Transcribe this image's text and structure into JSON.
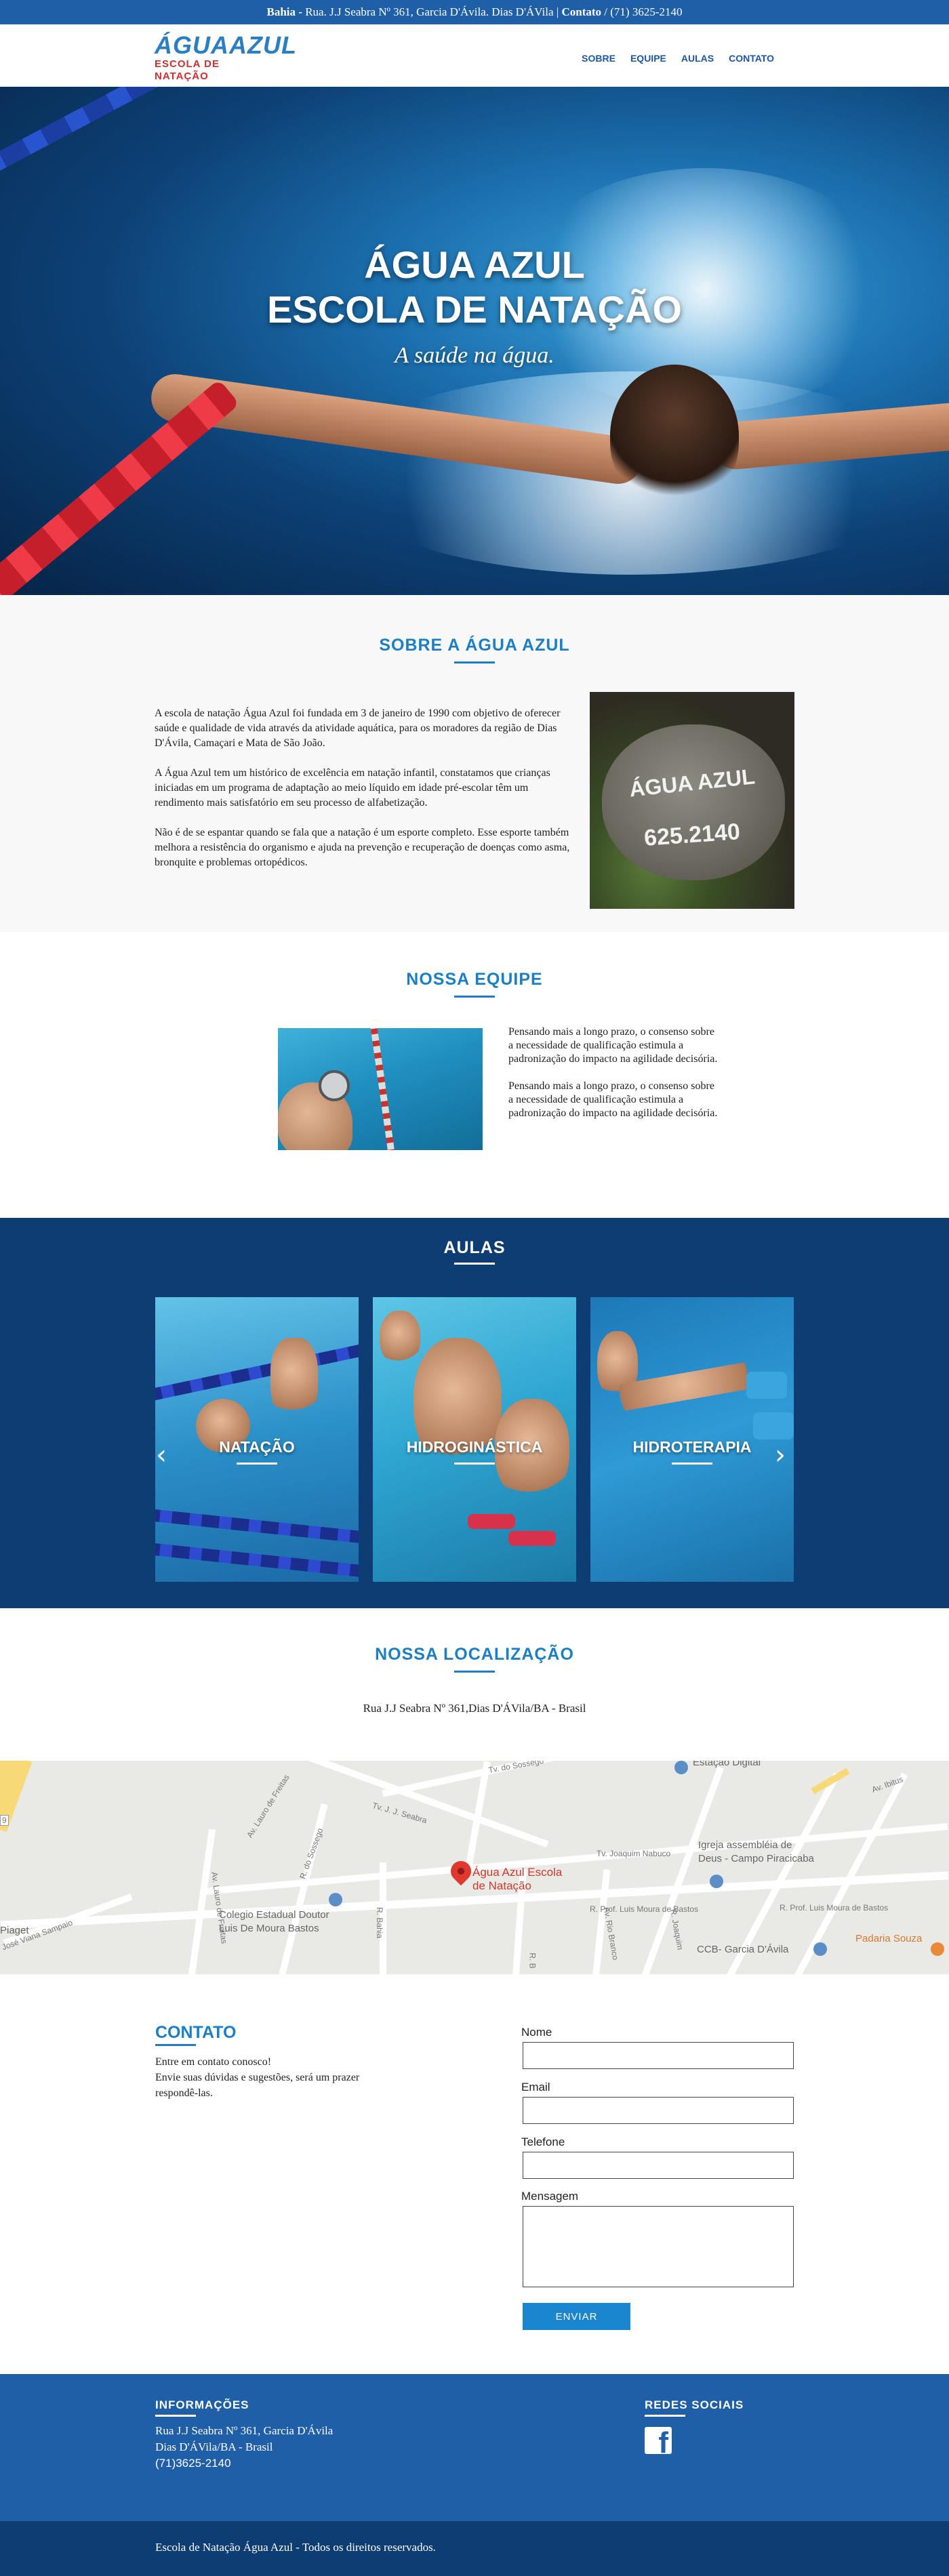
{
  "topbar": {
    "state": "Bahia",
    "dash": " - ",
    "address": "Rua. J.J Seabra Nº 361, Garcia D'Ávila. Dias D'ÁVila",
    "sep": " | ",
    "contact_label": "Contato",
    "phone": " / (71) 3625-2140"
  },
  "logo": {
    "top": "ÁGUAAZUL",
    "bottom": "ESCOLA DE NATAÇÃO"
  },
  "nav": [
    "SOBRE",
    "EQUIPE",
    "AULAS",
    "CONTATO"
  ],
  "hero": {
    "title_line1": "ÁGUA AZUL",
    "title_line2": "ESCOLA DE NATAÇÃO",
    "subtitle": "A saúde na água."
  },
  "sobre": {
    "title": "SOBRE A ÁGUA AZUL",
    "paragraphs": [
      "A escola de natação Água Azul foi fundada em 3 de janeiro de 1990 com objetivo de oferecer saúde e qualidade de vida através da atividade aquática, para os moradores da região de Dias D'Ávila, Camaçari e Mata de São João.",
      "A Água Azul tem um histórico de excelência em natação infantil, constatamos que crianças iniciadas em um programa de adaptação ao meio líquido em idade pré-escolar têm um rendimento mais satisfatório em seu processo de alfabetização.",
      "Não é de se espantar quando se fala que a natação é um esporte completo. Esse esporte também melhora a resistência do organismo e ajuda na prevenção e recuperação de doenças como asma, bronquite e problemas ortopédicos."
    ],
    "stone_text1": "ÁGUA AZUL",
    "stone_text2": "625.2140"
  },
  "equipe": {
    "title": "NOSSA EQUIPE",
    "paragraphs": [
      "Pensando mais a longo prazo, o consenso sobre a necessidade de qualificação estimula a padronização do impacto na agilidade decisória.",
      "Pensando mais a longo prazo, o consenso sobre a necessidade de qualificação estimula a padronização do impacto na agilidade decisória."
    ]
  },
  "aulas": {
    "title": "AULAS",
    "cards": [
      "NATAÇÃO",
      "HIDROGINÁSTICA",
      "HIDROTERAPIA"
    ],
    "prev_icon": "‹",
    "next_icon": "›"
  },
  "local": {
    "title": "NOSSA LOCALIZAÇÃO",
    "address": "Rua J.J Seabra Nº 361,Dias D'ÁVila/BA - Brasil"
  },
  "map": {
    "place_name_line1": "Água Azul Escola",
    "place_name_line2": "de Natação",
    "labels": {
      "colegio_line1": "Colegio Estadual Doutor",
      "colegio_line2": "Luis De Moura Bastos",
      "igreja_line1": "Igreja assembléia de",
      "igreja_line2": "Deus - Campo Piracicaba",
      "ccb": "CCB- Garcia D'Ávila",
      "padaria": "Padaria Souza",
      "estacao": "Estação Digital",
      "piaget": "Piaget",
      "av_ibitu": "Av. Ibitus",
      "tv_sossego": "Tv. do Sossego",
      "av_lauro1": "Av. Lauro de Freitas",
      "av_lauro2": "Av. Lauro de Freitas",
      "r_sossego": "R. do Sossego",
      "tv_seabra": "Tv. J. J. Seabra",
      "tv_nabuco": "Tv. Joaquim Nabuco",
      "r_prof1": "R. Prof. Luis Moura de Bastos",
      "r_prof2": "R. Prof. Luis Moura de Bastos",
      "jose_viana": "José Viana Sampaio",
      "r_bahia": "R. Bahia",
      "av_rio_branco": "Av. Rio Branco",
      "r_joaquim": "R. Joaquim",
      "r_b": "R. B",
      "sign": "9"
    }
  },
  "contato": {
    "title": "CONTATO",
    "line1": "Entre em contato conosco!",
    "line2": "Envie suas dúvidas e sugestões, será um prazer respondê-las.",
    "fields": {
      "nome": "Nome",
      "email": "Email",
      "telefone": "Telefone",
      "mensagem": "Mensagem"
    },
    "submit": "ENVIAR"
  },
  "footer": {
    "info_title": "INFORMAÇÕES",
    "info_line1": "Rua J.J Seabra Nº 361, Garcia D'Ávila",
    "info_line2": "Dias D'ÁVila/BA - Brasil",
    "info_phone": "(71)3625-2140",
    "social_title": "REDES SOCIAIS",
    "facebook_glyph": "f",
    "copyright": "Escola de Natação Água Azul - Todos os direitos reservados."
  },
  "colors": {
    "brand_blue": "#1f5fa8",
    "dark_blue": "#0e3d74",
    "accent_blue": "#1a7fc6",
    "logo_red": "#d92b2b",
    "button_blue": "#1a86cf"
  }
}
